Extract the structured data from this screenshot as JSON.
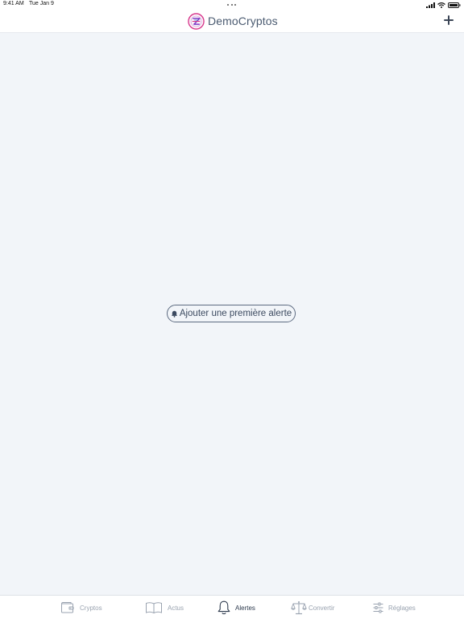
{
  "status_bar": {
    "time": "9:41 AM",
    "date": "Tue Jan 9"
  },
  "nav_bar": {
    "title": "DemoCryptos",
    "add_icon": "plus-icon",
    "logo_icon": "democryptos-logo"
  },
  "main": {
    "empty_state_button": "Ajouter une première alerte",
    "empty_state_icon": "bell-icon"
  },
  "tab_bar": {
    "tabs": [
      {
        "label": "Cryptos",
        "icon": "wallet-icon",
        "active": false
      },
      {
        "label": "Actus",
        "icon": "book-icon",
        "active": false
      },
      {
        "label": "Alertes",
        "icon": "bell-icon",
        "active": true
      },
      {
        "label": "Convertir",
        "icon": "scale-icon",
        "active": false
      },
      {
        "label": "Réglages",
        "icon": "sliders-icon",
        "active": false
      }
    ]
  },
  "colors": {
    "background": "#f2f5f9",
    "bar": "#ffffff",
    "text_primary": "#4a5a70",
    "tab_inactive": "#9aa3b0",
    "tab_active": "#2e3b4e",
    "logo_ring": "#d6338a"
  }
}
